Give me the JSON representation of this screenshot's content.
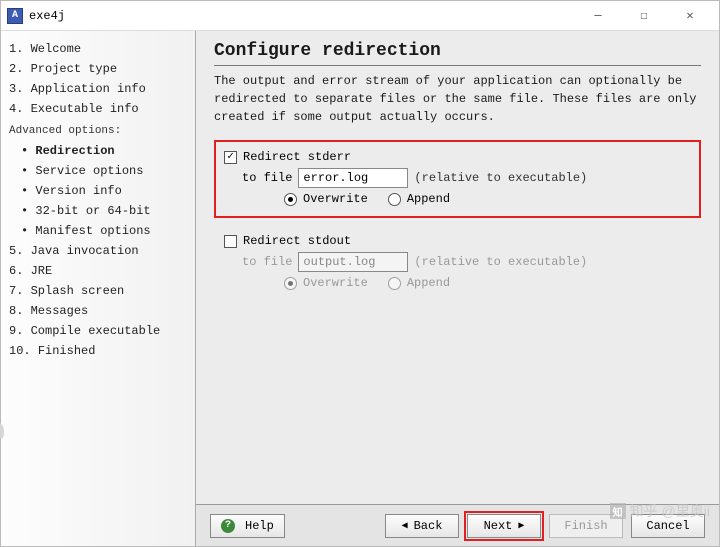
{
  "window": {
    "title": "exe4j",
    "brand": "exe4j"
  },
  "sidebar": {
    "steps": [
      {
        "n": "1.",
        "label": "Welcome"
      },
      {
        "n": "2.",
        "label": "Project type"
      },
      {
        "n": "3.",
        "label": "Application info"
      },
      {
        "n": "4.",
        "label": "Executable info"
      }
    ],
    "advanced_label": "Advanced options:",
    "advanced": [
      {
        "label": "Redirection",
        "current": true
      },
      {
        "label": "Service options"
      },
      {
        "label": "Version info"
      },
      {
        "label": "32-bit or 64-bit"
      },
      {
        "label": "Manifest options"
      }
    ],
    "steps2": [
      {
        "n": "5.",
        "label": "Java invocation"
      },
      {
        "n": "6.",
        "label": "JRE"
      },
      {
        "n": "7.",
        "label": "Splash screen"
      },
      {
        "n": "8.",
        "label": "Messages"
      },
      {
        "n": "9.",
        "label": "Compile executable"
      },
      {
        "n": "10.",
        "label": "Finished"
      }
    ]
  },
  "page": {
    "title": "Configure redirection",
    "description": "The output and error stream of your application can optionally be redirected to separate files or the same file. These files are only created if some output actually occurs."
  },
  "stderr": {
    "checkbox_label": "Redirect stderr",
    "checked": true,
    "to_file_label": "to file",
    "file_value": "error.log",
    "hint": "(relative to executable)",
    "overwrite_label": "Overwrite",
    "append_label": "Append",
    "mode": "overwrite"
  },
  "stdout": {
    "checkbox_label": "Redirect stdout",
    "checked": false,
    "to_file_label": "to file",
    "file_value": "output.log",
    "hint": "(relative to executable)",
    "overwrite_label": "Overwrite",
    "append_label": "Append",
    "mode": "overwrite"
  },
  "footer": {
    "help": "Help",
    "back": "Back",
    "next": "Next",
    "finish": "Finish",
    "cancel": "Cancel"
  },
  "watermark": "知乎 @里奥ii"
}
